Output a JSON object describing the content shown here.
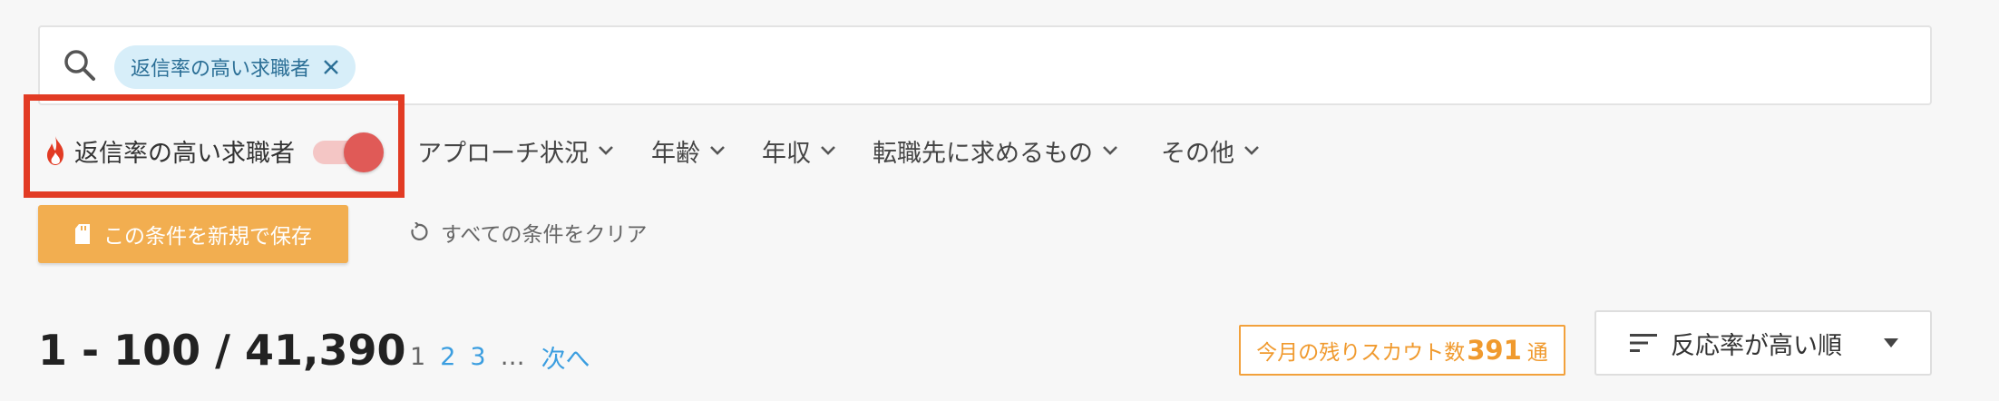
{
  "search": {
    "chip_label": "返信率の高い求職者"
  },
  "filters": {
    "toggle_label": "返信率の高い求職者",
    "toggle_on": true,
    "dropdowns": [
      "アプローチ状況",
      "年齢",
      "年収",
      "転職先に求めるもの",
      "その他"
    ]
  },
  "actions": {
    "save_label": "この条件を新規で保存",
    "clear_label": "すべての条件をクリア"
  },
  "results": {
    "count_text": "1 - 100 / 41,390"
  },
  "pager": {
    "current": "1",
    "pages": [
      "2",
      "3"
    ],
    "ellipsis": "…",
    "next_label": "次へ"
  },
  "scout": {
    "prefix": "今月の残りスカウト数",
    "count": "391",
    "suffix": "通"
  },
  "sort": {
    "label": "反応率が高い順"
  },
  "colors": {
    "highlight": "#e23b24",
    "accent_orange": "#f2ae50",
    "link_blue": "#3b9ee0",
    "toggle_on": "#e05a57"
  }
}
